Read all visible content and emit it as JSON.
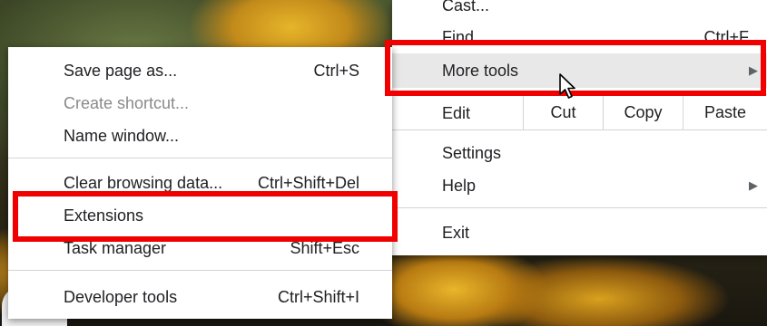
{
  "main_menu": {
    "cast": "Cast...",
    "find": {
      "label": "Find",
      "shortcut": "Ctrl+F"
    },
    "more_tools": "More tools",
    "edit": {
      "label": "Edit",
      "cut": "Cut",
      "copy": "Copy",
      "paste": "Paste"
    },
    "settings": "Settings",
    "help": "Help",
    "exit": "Exit"
  },
  "sub_menu": {
    "save_page": {
      "label": "Save page as...",
      "shortcut": "Ctrl+S"
    },
    "create_shortcut": {
      "label": "Create shortcut..."
    },
    "name_window": {
      "label": "Name window..."
    },
    "clear_browsing": {
      "label": "Clear browsing data...",
      "shortcut": "Ctrl+Shift+Del"
    },
    "extensions": {
      "label": "Extensions"
    },
    "task_manager": {
      "label": "Task manager",
      "shortcut": "Shift+Esc"
    },
    "developer_tools": {
      "label": "Developer tools",
      "shortcut": "Ctrl+Shift+I"
    }
  },
  "colors": {
    "highlight_box": "#f00000",
    "hover_background": "#e8e8e8"
  },
  "icons": {
    "submenu_arrow": "chevron-right-icon",
    "pointer": "mouse-cursor-icon"
  }
}
